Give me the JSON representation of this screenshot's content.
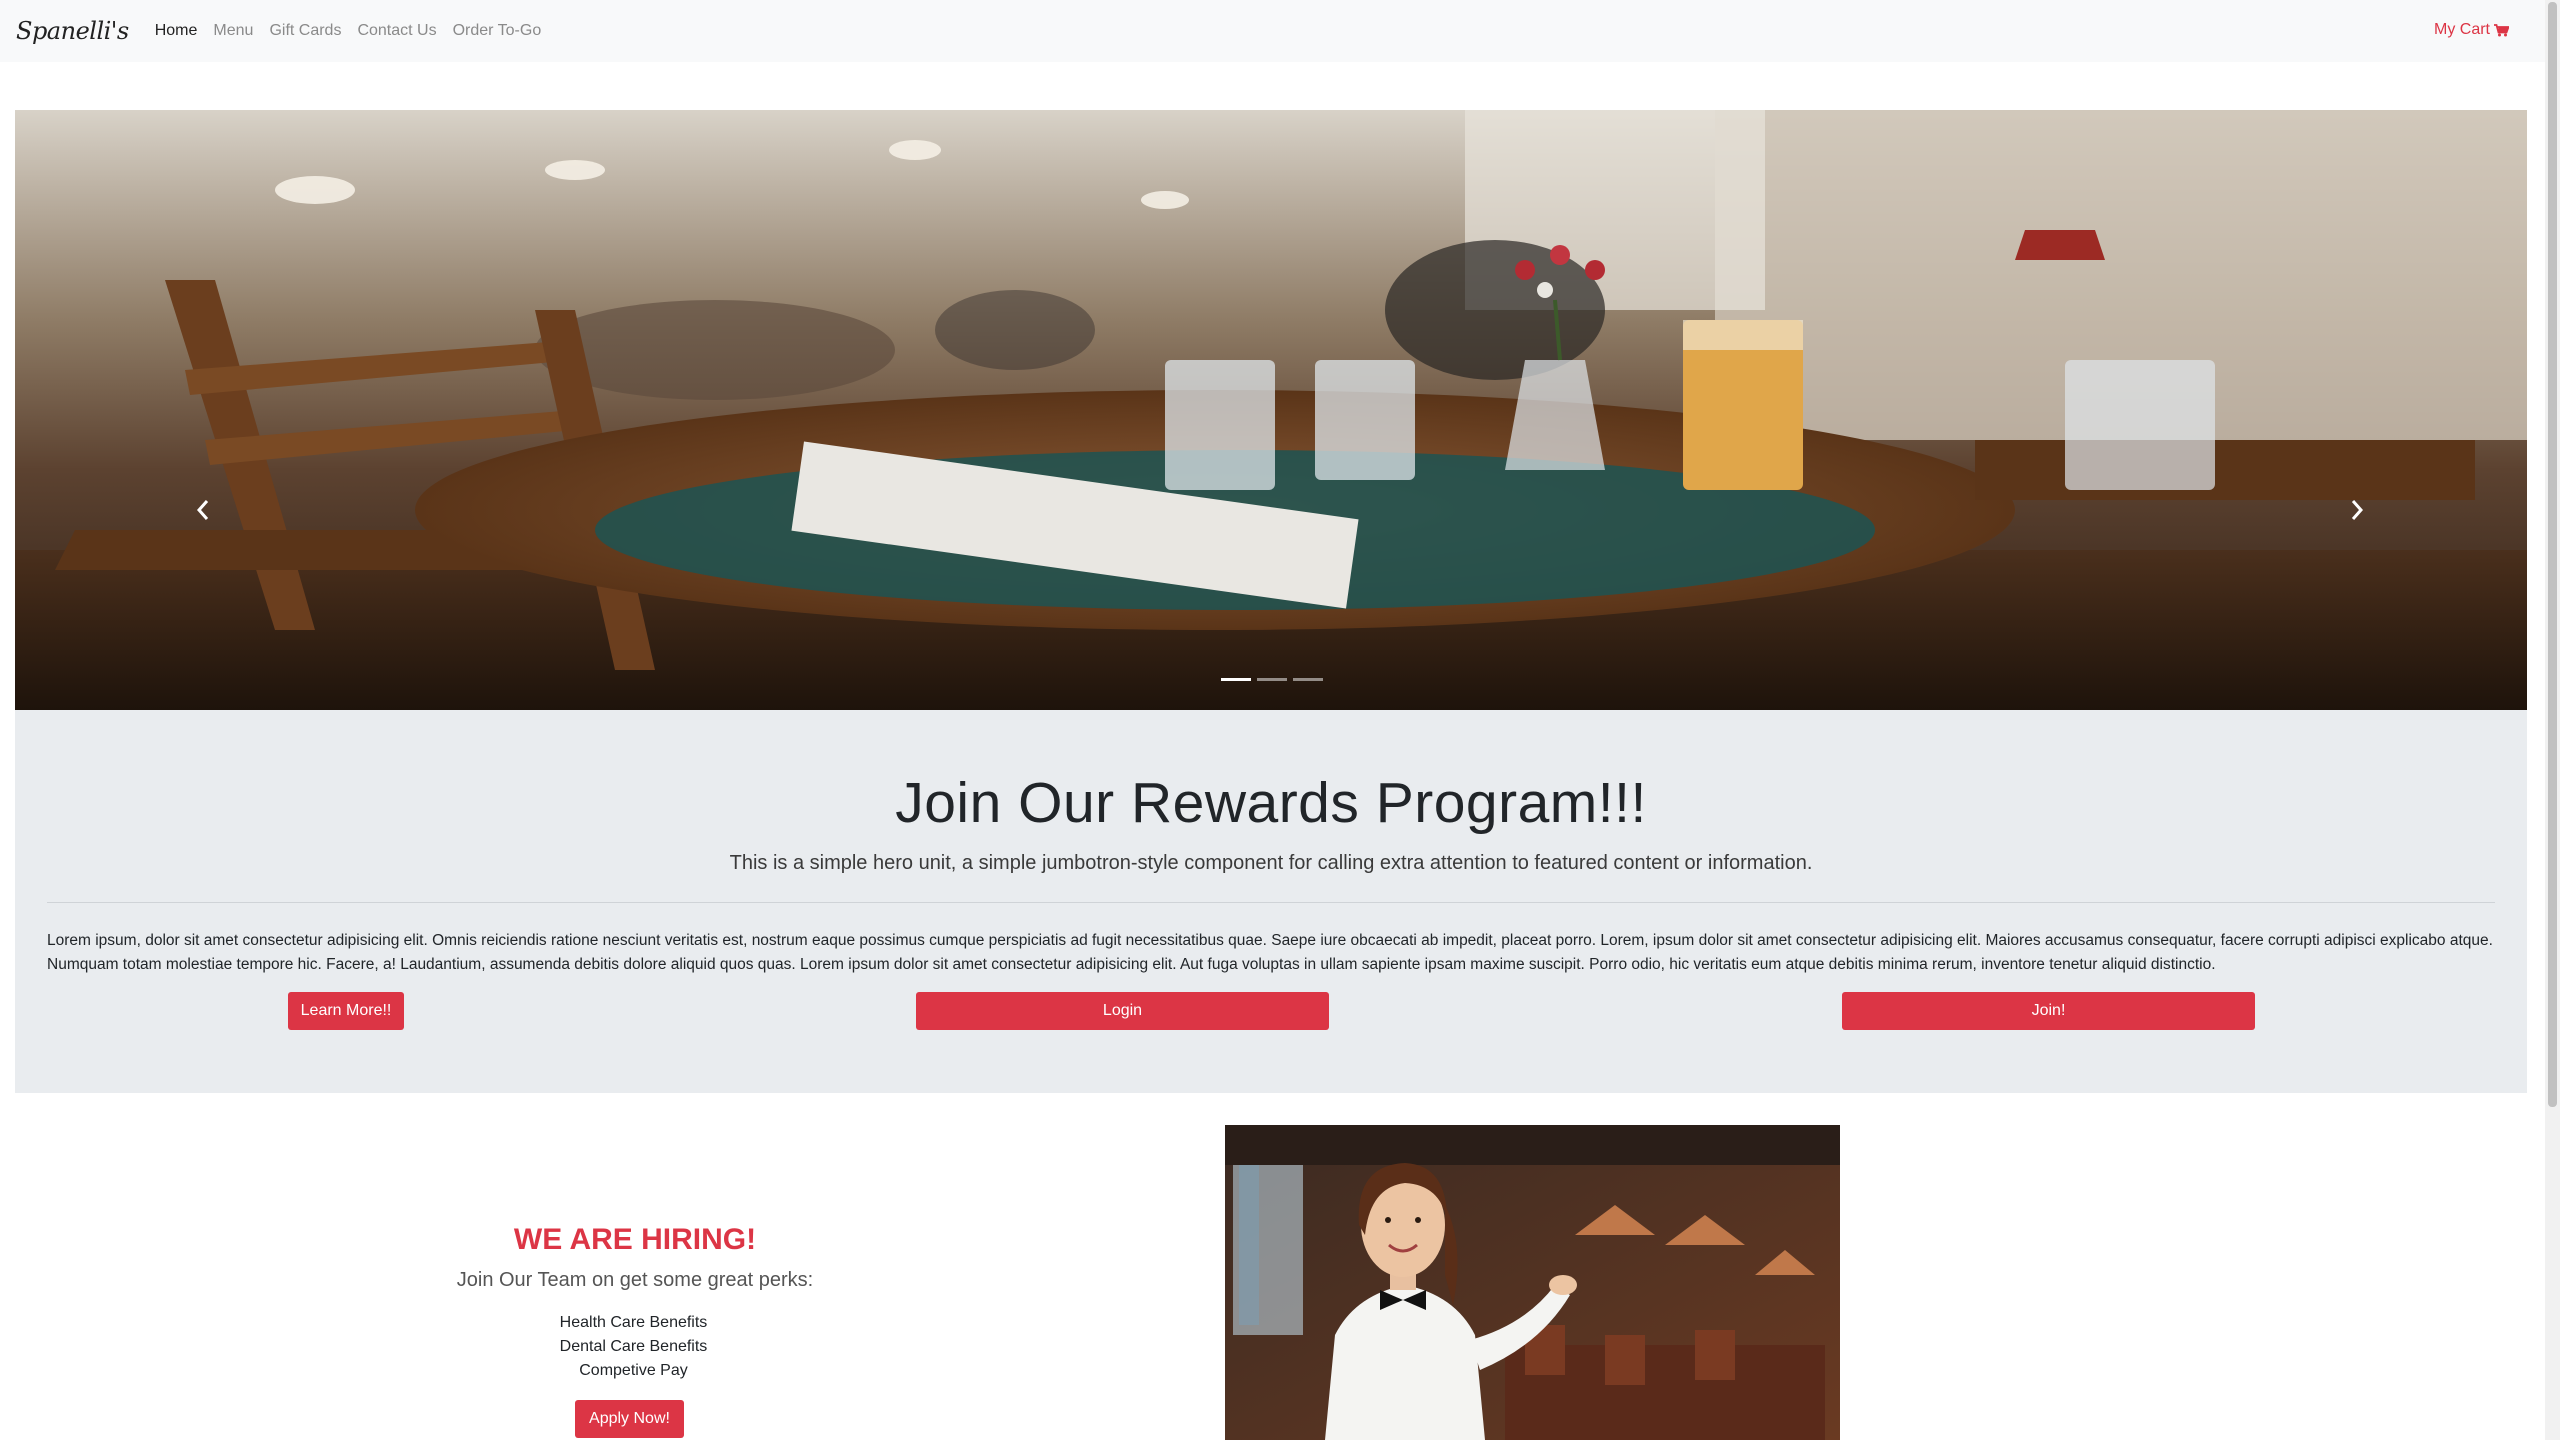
{
  "nav": {
    "brand": "Spanelli's",
    "links": [
      {
        "label": "Home",
        "active": true
      },
      {
        "label": "Menu",
        "active": false
      },
      {
        "label": "Gift Cards",
        "active": false
      },
      {
        "label": "Contact Us",
        "active": false
      },
      {
        "label": "Order To-Go",
        "active": false
      }
    ],
    "cart_label": "My Cart",
    "cart_icon": "shopping-cart-icon"
  },
  "carousel": {
    "prev_icon": "chevron-left-icon",
    "next_icon": "chevron-right-icon",
    "slide_count": 3,
    "active_slide": 1
  },
  "jumbotron": {
    "title": "Join Our Rewards Program!!!",
    "lead": "This is a simple hero unit, a simple jumbotron-style component for calling extra attention to featured content or information.",
    "body": "Lorem ipsum, dolor sit amet consectetur adipisicing elit. Omnis reiciendis ratione nesciunt veritatis est, nostrum eaque possimus cumque perspiciatis ad fugit necessitatibus quae. Saepe iure obcaecati ab impedit, placeat porro. Lorem, ipsum dolor sit amet consectetur adipisicing elit. Maiores accusamus consequatur, facere corrupti adipisci explicabo atque. Numquam totam molestiae tempore hic. Facere, a! Laudantium, assumenda debitis dolore aliquid quos quas. Lorem ipsum dolor sit amet consectetur adipisicing elit. Aut fuga voluptas in ullam sapiente ipsam maxime suscipit. Porro odio, hic veritatis eum atque debitis minima rerum, inventore tenetur aliquid distinctio.",
    "learn_more_label": "Learn More!!",
    "login_label": "Login",
    "join_label": "Join!"
  },
  "hiring": {
    "title": "WE ARE HIRING!",
    "subtitle": "Join Our Team on get some great perks:",
    "perks": [
      "Health Care Benefits",
      "Dental Care Benefits",
      "Competive Pay"
    ],
    "apply_label": "Apply Now!"
  },
  "colors": {
    "accent": "#dc3545",
    "navbar_bg": "#f8f9fa",
    "jumbotron_bg": "#e9ecef"
  }
}
